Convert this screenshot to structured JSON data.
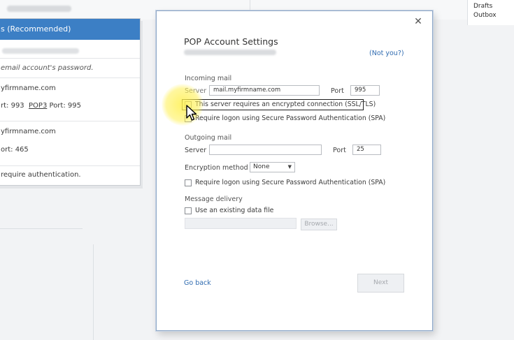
{
  "background": {
    "folders": [
      "Drafts",
      "Outbox"
    ],
    "left_panel": {
      "header": "s (Recommended)",
      "password_hint": "email account's password.",
      "incoming_server": "yfirmname.com",
      "incoming_port_prefix": "rt: 993",
      "pop3_link": "POP3",
      "pop3_port": "Port: 995",
      "outgoing_server": "yfirmname.com",
      "outgoing_port": "ort: 465",
      "auth_note": "require authentication."
    }
  },
  "dialog": {
    "title": "POP Account Settings",
    "not_you": "(Not you?)",
    "incoming": {
      "section": "Incoming mail",
      "server_label": "Server",
      "server_value": "mail.myfirmname.com",
      "port_label": "Port",
      "port_value": "995",
      "ssl_label": "This server requires an encrypted connection (SSL/TLS)",
      "spa_label": "Require logon using Secure Password Authentication (SPA)"
    },
    "outgoing": {
      "section": "Outgoing mail",
      "server_label": "Server",
      "server_value": "",
      "port_label": "Port",
      "port_value": "25",
      "encryption_label": "Encryption method",
      "encryption_value": "None",
      "spa_label": "Require logon using Secure Password Authentication (SPA)"
    },
    "delivery": {
      "section": "Message delivery",
      "existing_label": "Use an existing data file",
      "browse_label": "Browse..."
    },
    "go_back": "Go back",
    "next": "Next"
  },
  "icons": {
    "close": "close-icon",
    "dropdown": "chevron-down-icon",
    "cursor": "mouse-pointer-icon"
  },
  "colors": {
    "accent": "#3c7fc5",
    "link": "#2f6bb0",
    "dialog_border": "#8ea7c7",
    "highlight": "#fff050"
  }
}
